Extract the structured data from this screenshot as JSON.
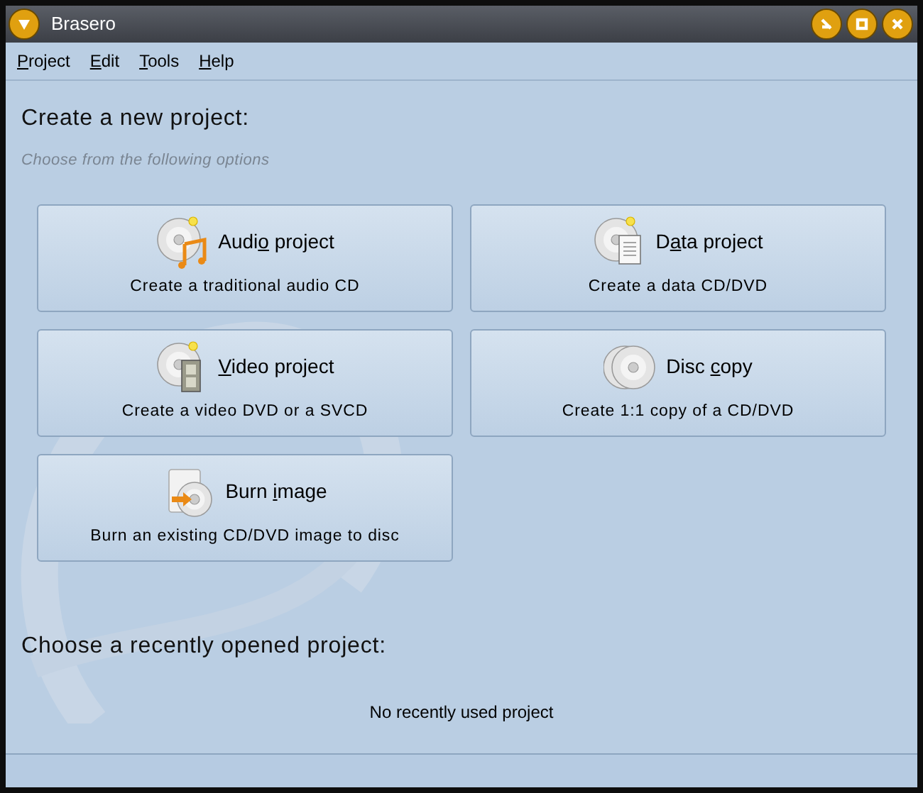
{
  "window": {
    "title": "Brasero"
  },
  "menu": [
    {
      "key": "P",
      "after": "roject"
    },
    {
      "key": "E",
      "after": "dit"
    },
    {
      "key": "T",
      "after": "ools"
    },
    {
      "key": "H",
      "after": "elp"
    }
  ],
  "new_project": {
    "heading": "Create a new project:",
    "hint": "Choose from the following options",
    "options": [
      {
        "kind": "audio",
        "title": {
          "before": "Audi",
          "key": "o",
          "after": " project"
        },
        "description": "Create a traditional audio CD"
      },
      {
        "kind": "data",
        "title": {
          "before": "D",
          "key": "a",
          "after": "ta project"
        },
        "description": "Create a data CD/DVD"
      },
      {
        "kind": "video",
        "title": {
          "key": "V",
          "after": "ideo project"
        },
        "description": "Create a video DVD or a SVCD"
      },
      {
        "kind": "copy",
        "title": {
          "before": "Disc ",
          "key": "c",
          "after": "opy"
        },
        "description": "Create 1:1 copy of a CD/DVD"
      },
      {
        "kind": "image",
        "title": {
          "before": "Burn ",
          "key": "i",
          "after": "mage"
        },
        "description": "Burn an existing CD/DVD image to disc"
      }
    ]
  },
  "recent": {
    "heading": "Choose a recently opened project:",
    "empty_text": "No recently used project"
  }
}
